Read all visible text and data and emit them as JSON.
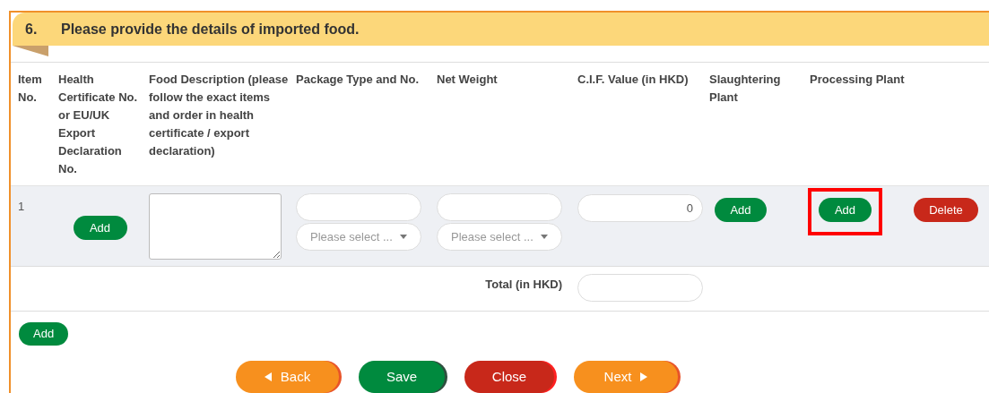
{
  "section": {
    "number": "6.",
    "title": "Please provide the details of imported food."
  },
  "table": {
    "columns": [
      "Item No.",
      "Health Certificate No. or EU/UK Export Declaration No.",
      "Food Description (please follow the exact items and order in health certificate / export declaration)",
      "Package Type and No.",
      "Net Weight",
      "C.I.F. Value (in HKD)",
      "Slaughtering Plant",
      "Processing Plant"
    ],
    "rows": [
      {
        "item_no": "1",
        "health_certificate_button": "Add",
        "package_select": {
          "placeholder": "Please select ..."
        },
        "net_weight_select": {
          "placeholder": "Please select ..."
        },
        "cif_value": "0",
        "slaughtering_plant_button": "Add",
        "processing_plant_button": {
          "label": "Add",
          "highlighted": true
        },
        "delete_button": "Delete"
      }
    ],
    "total": {
      "label": "Total (in HKD)"
    }
  },
  "add_row_button": "Add",
  "nav_buttons": [
    {
      "label": "Back",
      "kind": "back"
    },
    {
      "label": "Save",
      "kind": "save"
    },
    {
      "label": "Close",
      "kind": "close"
    },
    {
      "label": "Next",
      "kind": "next"
    }
  ]
}
